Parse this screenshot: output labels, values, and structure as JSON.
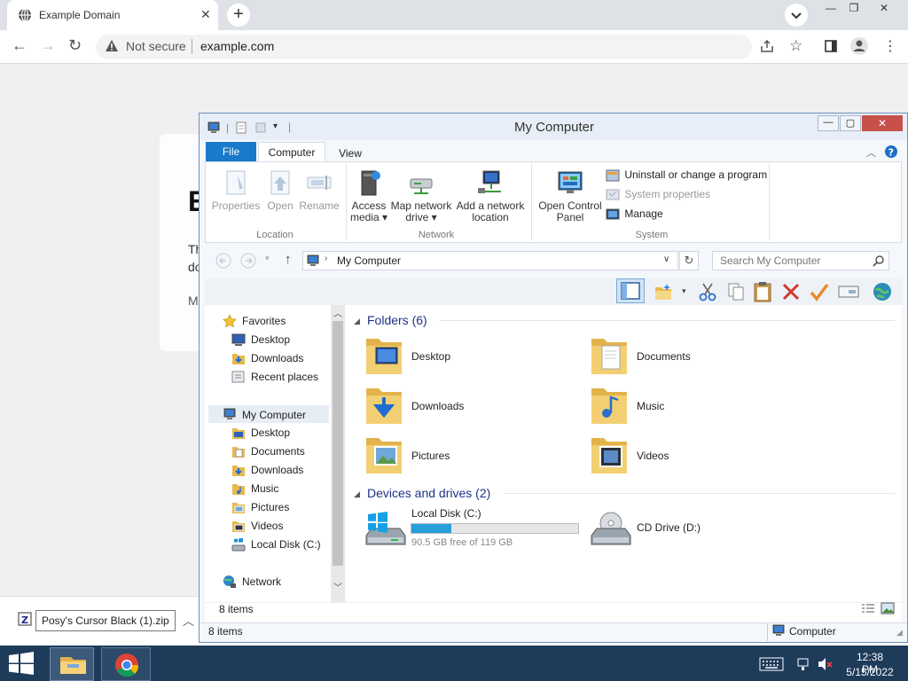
{
  "browser": {
    "tab_title": "Example Domain",
    "security_label": "Not secure",
    "url": "example.com",
    "window_controls": [
      "—",
      "❐",
      "✕"
    ],
    "download_filename": "Posy's Cursor Black (1).zip"
  },
  "page": {
    "heading_fragment": "E",
    "line1": "Th",
    "line2": "do",
    "line3": "M"
  },
  "explorer": {
    "title": "My Computer",
    "ribbon_tabs": {
      "file": "File",
      "computer": "Computer",
      "view": "View"
    },
    "location_group": {
      "label": "Location",
      "buttons": [
        "Properties",
        "Open",
        "Rename"
      ]
    },
    "network_group": {
      "label": "Network",
      "buttons": [
        [
          "Access",
          "media ▾"
        ],
        [
          "Map network",
          "drive ▾"
        ],
        [
          "Add a network",
          "location"
        ]
      ]
    },
    "system_group": {
      "label": "System",
      "open_control_panel": [
        "Open Control",
        "Panel"
      ],
      "links": [
        "Uninstall or change a program",
        "System properties",
        "Manage"
      ]
    },
    "address": "My Computer",
    "search_placeholder": "Search My Computer",
    "nav": {
      "favorites_header": "Favorites",
      "favorites": [
        "Desktop",
        "Downloads",
        "Recent places"
      ],
      "computer_header": "My Computer",
      "computer": [
        "Desktop",
        "Documents",
        "Downloads",
        "Music",
        "Pictures",
        "Videos",
        "Local Disk (C:)"
      ],
      "network": "Network"
    },
    "folders_header": "Folders (6)",
    "folders": [
      "Desktop",
      "Documents",
      "Downloads",
      "Music",
      "Pictures",
      "Videos"
    ],
    "drives_header": "Devices and drives (2)",
    "drives": [
      {
        "name": "Local Disk (C:)",
        "free": "90.5 GB free of 119 GB",
        "used_fraction": 0.24
      },
      {
        "name": "CD Drive (D:)"
      }
    ],
    "inner_status": "8 items",
    "status": "8 items",
    "status_location": "Computer"
  },
  "taskbar": {
    "time": "12:38 PM",
    "date": "5/15/2022"
  },
  "colors": {
    "accent": "#1979ca",
    "taskbar": "#1f3b5a",
    "folder": "#f0c75e"
  }
}
